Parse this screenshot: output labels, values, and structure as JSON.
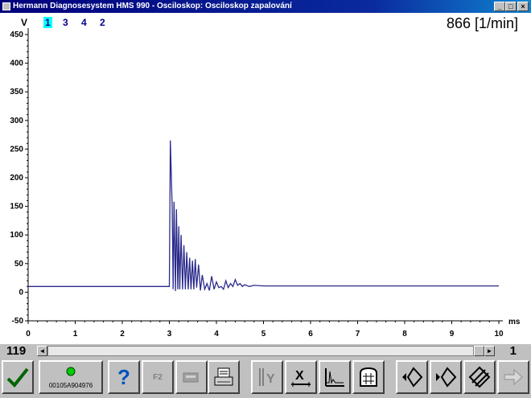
{
  "window": {
    "title": "Hermann Diagnosesystem HMS 990 - Osciloskop: Osciloskop zapalování"
  },
  "header": {
    "unit_label": "V",
    "channels": [
      {
        "label": "1",
        "active": true
      },
      {
        "label": "3",
        "active": false
      },
      {
        "label": "4",
        "active": false
      },
      {
        "label": "2",
        "active": false
      }
    ],
    "rpm_readout": "866 [1/min]"
  },
  "chart_data": {
    "type": "line",
    "xlabel": "ms",
    "ylabel": "V",
    "xlim": [
      0,
      10
    ],
    "ylim": [
      -50,
      450
    ],
    "x_ticks": [
      "0",
      "1",
      "2",
      "3",
      "4",
      "5",
      "6",
      "7",
      "8",
      "9",
      "10"
    ],
    "y_ticks": [
      "-50",
      "0",
      "50",
      "100",
      "150",
      "200",
      "250",
      "300",
      "350",
      "400",
      "450"
    ],
    "grid": false,
    "series": [
      {
        "color": "#2a2a8c",
        "x": [
          0,
          3.0,
          3.02,
          3.06,
          3.08,
          3.1,
          3.13,
          3.15,
          3.18,
          3.2,
          3.22,
          3.25,
          3.28,
          3.31,
          3.34,
          3.37,
          3.4,
          3.43,
          3.46,
          3.49,
          3.52,
          3.55,
          3.58,
          3.62,
          3.66,
          3.7,
          3.75,
          3.8,
          3.85,
          3.9,
          3.95,
          4.0,
          4.05,
          4.1,
          4.15,
          4.2,
          4.25,
          4.3,
          4.35,
          4.4,
          4.45,
          4.5,
          4.55,
          4.6,
          4.7,
          4.8,
          5.0,
          10
        ],
        "y": [
          10,
          10,
          265,
          150,
          5,
          158,
          2,
          145,
          5,
          115,
          5,
          100,
          5,
          82,
          5,
          70,
          5,
          60,
          5,
          55,
          5,
          58,
          8,
          48,
          3,
          30,
          5,
          15,
          3,
          28,
          5,
          18,
          8,
          10,
          5,
          20,
          8,
          15,
          10,
          22,
          12,
          15,
          10,
          13,
          10,
          12,
          11,
          11
        ]
      }
    ]
  },
  "scrollbar": {
    "left_value": "119",
    "right_value": "1",
    "left_arrow": "◄",
    "right_arrow": "►"
  },
  "toolbar": {
    "serial_number": "00105A904976",
    "f2_label": "F2",
    "help_label": "?",
    "status_led_color": "#00cc00"
  }
}
